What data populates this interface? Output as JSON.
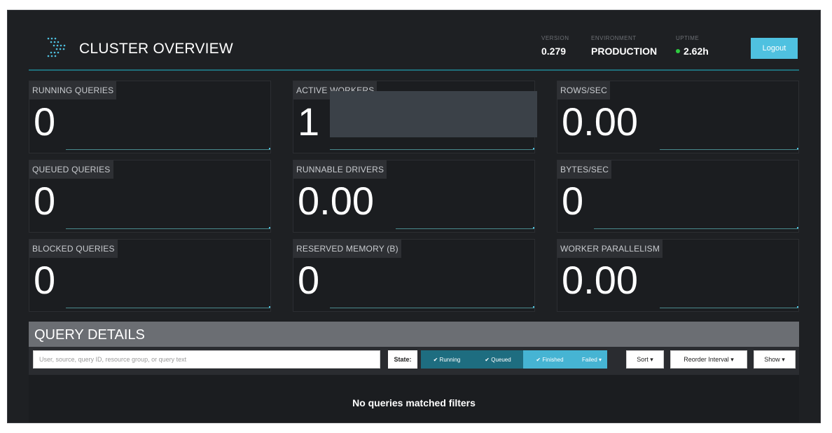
{
  "header": {
    "title": "CLUSTER OVERVIEW",
    "version_label": "VERSION",
    "version_value": "0.279",
    "environment_label": "ENVIRONMENT",
    "environment_value": "PRODUCTION",
    "uptime_label": "UPTIME",
    "uptime_value": "2.62h",
    "logout_label": "Logout"
  },
  "metrics": [
    {
      "label": "RUNNING QUERIES",
      "value": "0"
    },
    {
      "label": "ACTIVE WORKERS",
      "value": "1"
    },
    {
      "label": "ROWS/SEC",
      "value": "0.00"
    },
    {
      "label": "QUEUED QUERIES",
      "value": "0"
    },
    {
      "label": "RUNNABLE DRIVERS",
      "value": "0.00"
    },
    {
      "label": "BYTES/SEC",
      "value": "0"
    },
    {
      "label": "BLOCKED QUERIES",
      "value": "0"
    },
    {
      "label": "RESERVED MEMORY (B)",
      "value": "0"
    },
    {
      "label": "WORKER PARALLELISM",
      "value": "0.00"
    }
  ],
  "query_details": {
    "title": "QUERY DETAILS",
    "search_placeholder": "User, source, query ID, resource group, or query text",
    "state_label": "State:",
    "filters": {
      "running": "✔ Running",
      "queued": "✔ Queued",
      "finished": "✔ Finished",
      "failed": "Failed ▾"
    },
    "sort_label": "Sort ▾",
    "reorder_label": "Reorder Interval ▾",
    "show_label": "Show ▾",
    "empty_message": "No queries matched filters"
  },
  "colors": {
    "accent": "#4fc1e0",
    "background": "#1e2023",
    "uptime_dot": "#2ecc40"
  }
}
